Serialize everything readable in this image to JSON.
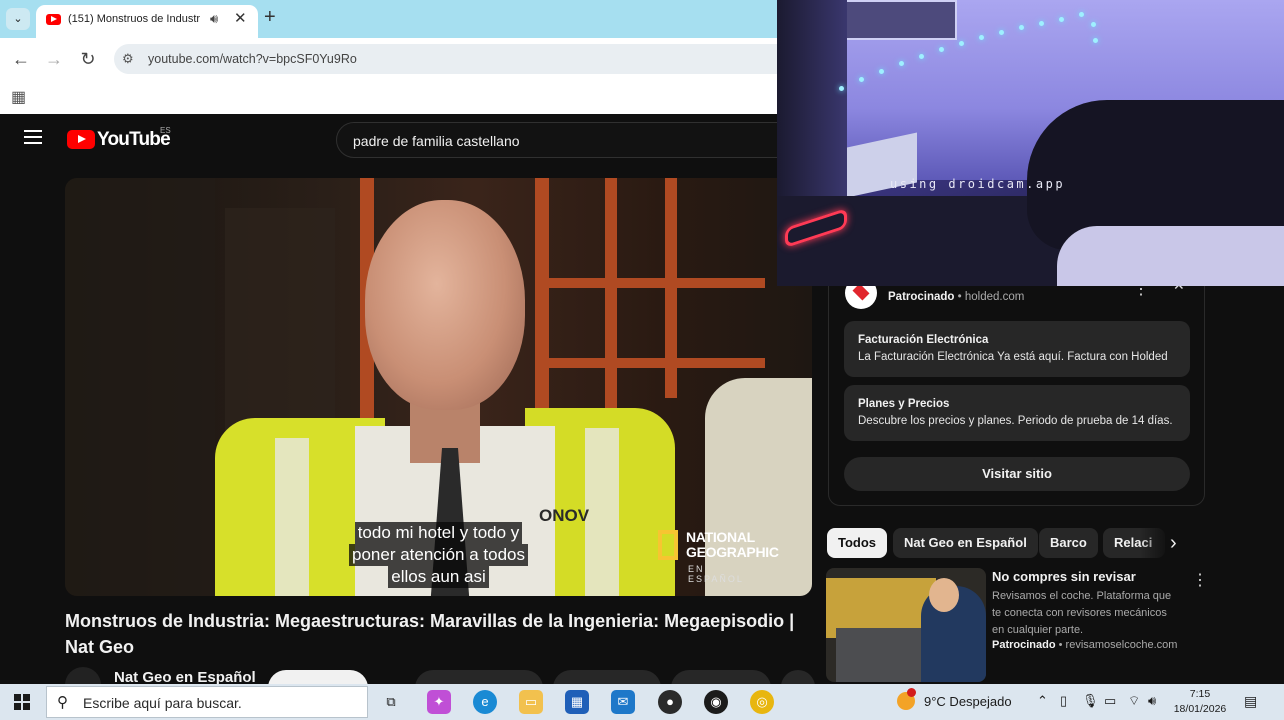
{
  "browser": {
    "tab_title": "(151) Monstruos de Industr",
    "new_tab": "+",
    "url": "youtube.com/watch?v=bpcSF0Yu9Ro"
  },
  "youtube": {
    "logo_text": "YouTube",
    "country": "ES",
    "search_value": "padre de familia castellano"
  },
  "video": {
    "subtitles": [
      "todo mi hotel y todo y",
      "poner atención a todos",
      "ellos aun asi"
    ],
    "watermark": [
      "NATIONAL",
      "GEOGRAPHIC",
      "EN ESPAÑOL"
    ],
    "vest_letters": "ONOV",
    "title": "Monstruos de Industria: Megaestructuras: Maravillas de la Ingenieria: Megaepisodio | Nat Geo",
    "channel": "Nat Geo en Español"
  },
  "ad": {
    "sponsored": "Patrocinado",
    "domain": "holded.com",
    "links": [
      {
        "title": "Facturación Electrónica",
        "desc": "La Facturación Electrónica Ya está aquí. Factura con Holded"
      },
      {
        "title": "Planes y Precios",
        "desc": "Descubre los precios y planes. Periodo de prueba de 14 días."
      }
    ],
    "cta": "Visitar sitio"
  },
  "chips": [
    "Todos",
    "Nat Geo en Español",
    "Barco",
    "Relaci"
  ],
  "recommendation": {
    "title": "No compres sin revisar",
    "description": "Revisamos el coche. Plataforma que te conecta con revisores mecánicos en cualquier parte.",
    "sponsored": "Patrocinado",
    "domain": "revisamoselcoche.com"
  },
  "webcam": {
    "watermark": "using droidcam.app"
  },
  "taskbar": {
    "search_placeholder": "Escribe aquí para buscar.",
    "weather": "9°C  Despejado",
    "time": "7:15",
    "date": "18/01/2026"
  },
  "colors": {
    "yt_background": "#0f0f0f",
    "yt_red": "#ff0000",
    "chrome_tabstrip": "#a6dff0",
    "taskbar": "#dce6ef"
  }
}
